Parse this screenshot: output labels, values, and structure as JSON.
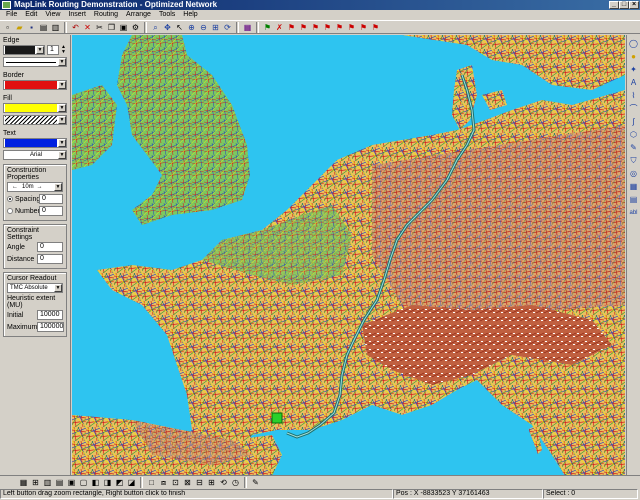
{
  "window": {
    "title": "MapLink Routing Demonstration - Optimized Network",
    "minimize": "_",
    "maximize": "□",
    "close": "×"
  },
  "menu": [
    "File",
    "Edit",
    "View",
    "Insert",
    "Routing",
    "Arrange",
    "Tools",
    "Help"
  ],
  "panel": {
    "edge_label": "Edge",
    "edge_width": "1",
    "border_label": "Border",
    "fill_label": "Fill",
    "text_label": "Text",
    "font_value": "Arial",
    "construction_label": "Construction Properties",
    "construction_distance": "10m",
    "spacing_label": "Spacing",
    "spacing_value": "0",
    "number_label": "Number",
    "number_value": "0",
    "constraint_label": "Constraint Settings",
    "angle_label": "Angle",
    "angle_value": "0",
    "distance_label": "Distance",
    "distance_value": "0",
    "cursor_label": "Cursor Readout",
    "cursor_value": "TMC Absolute",
    "heuristic_label": "Heuristic extent (MU)",
    "initial_label": "Initial",
    "initial_value": "10000",
    "maximum_label": "Maximum",
    "maximum_value": "100000"
  },
  "colors": {
    "edge": "#1a1a1a",
    "border": "#e01010",
    "fill": "#ffff00",
    "text": "#0020e0",
    "sea": "#2ec4f0"
  },
  "status": {
    "hint": "Left button drag zoom rectangle, Right button click to finish",
    "pos": "Pos : X -8833523   Y 37161463",
    "select": "Select : 0"
  }
}
